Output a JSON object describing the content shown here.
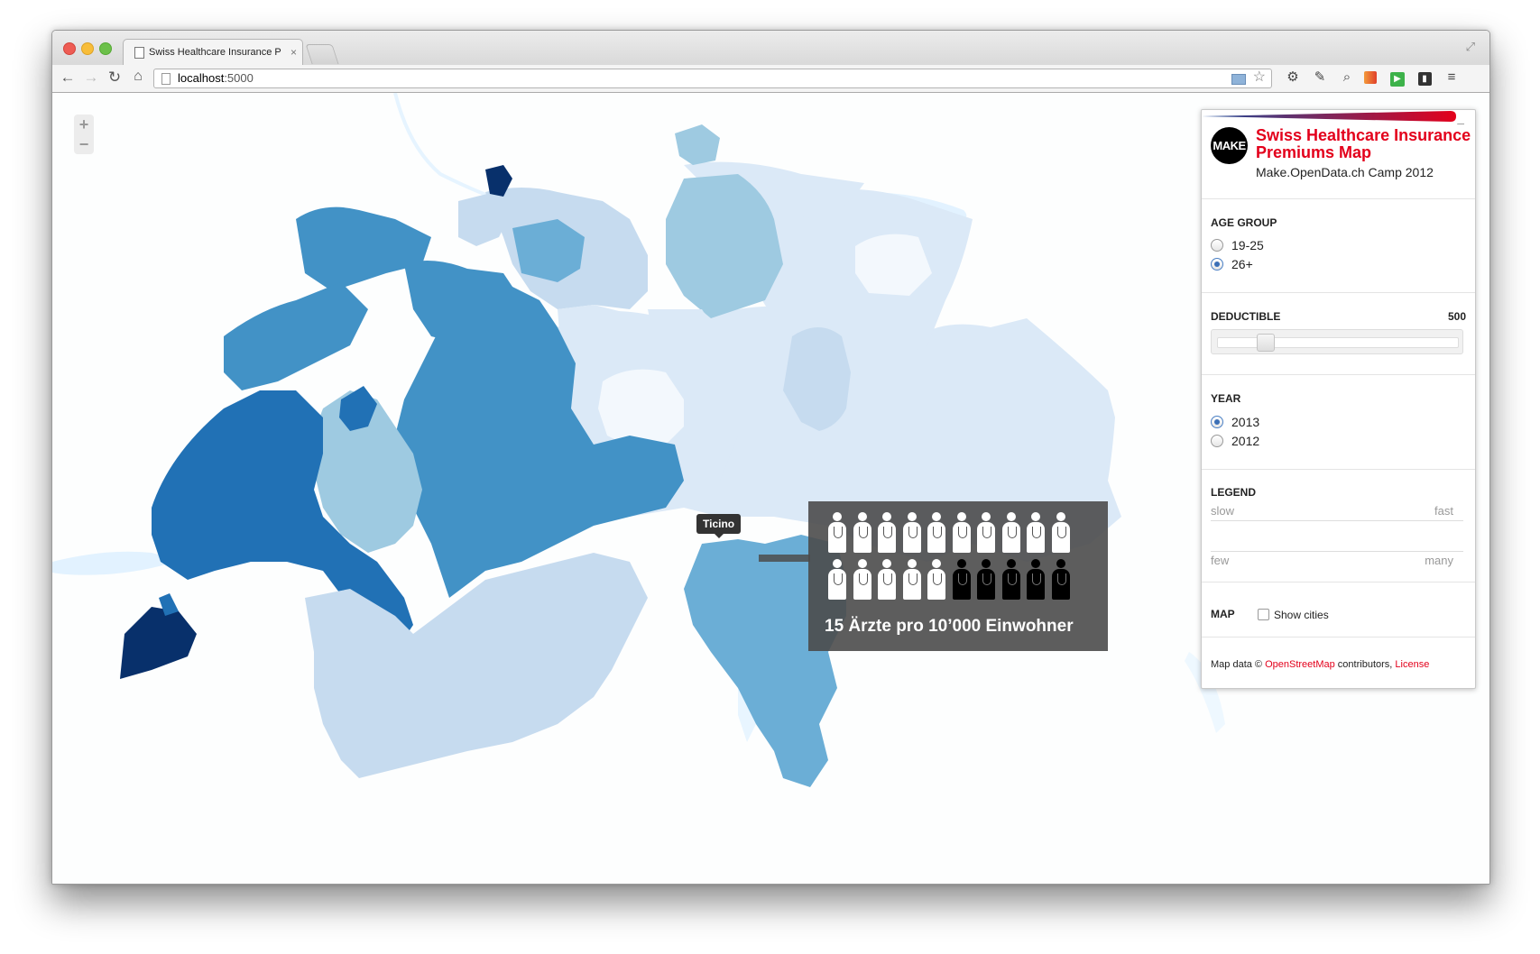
{
  "browser": {
    "tab_title": "Swiss Healthcare Insurance P",
    "tab_close": "×",
    "url_host": "localhost",
    "url_port": ":5000"
  },
  "map": {
    "zoom_in": "+",
    "zoom_out": "−",
    "tooltip": "Ticino",
    "infobox_text": "15 Ärzte pro 10’000 Einwohner",
    "doctors_total": 20,
    "doctors_highlighted": 15,
    "colors": {
      "level1": "#f3f8fd",
      "level2": "#dbe9f7",
      "level3": "#c6dbef",
      "level4": "#9ecae1",
      "level5": "#6baed6",
      "level6": "#4292c6",
      "level7": "#2171b5",
      "level8": "#08306b",
      "water": "#ddefff"
    }
  },
  "panel": {
    "minimize": "–",
    "logo_text": "MAKE",
    "title": "Swiss Healthcare Insurance Premiums Map",
    "subtitle": "Make.OpenData.ch Camp 2012",
    "age_group": {
      "title": "AGE GROUP",
      "options": [
        {
          "label": "19-25",
          "checked": false
        },
        {
          "label": "26+",
          "checked": true
        }
      ]
    },
    "deductible": {
      "title": "DEDUCTIBLE",
      "value": "500",
      "slider_fraction": 0.2
    },
    "year": {
      "title": "YEAR",
      "options": [
        {
          "label": "2013",
          "checked": true
        },
        {
          "label": "2012",
          "checked": false
        }
      ]
    },
    "legend": {
      "title": "LEGEND",
      "slow": "slow",
      "fast": "fast",
      "few": "few",
      "many": "many",
      "gradient_start": "#1b4b9a",
      "gradient_end": "#e3001b"
    },
    "map_section": {
      "title": "MAP",
      "show_cities": "Show cities",
      "show_cities_checked": false
    },
    "attribution": {
      "prefix": "Map data © ",
      "osm": "OpenStreetMap",
      "middle": " contributors, ",
      "license": "License"
    }
  }
}
